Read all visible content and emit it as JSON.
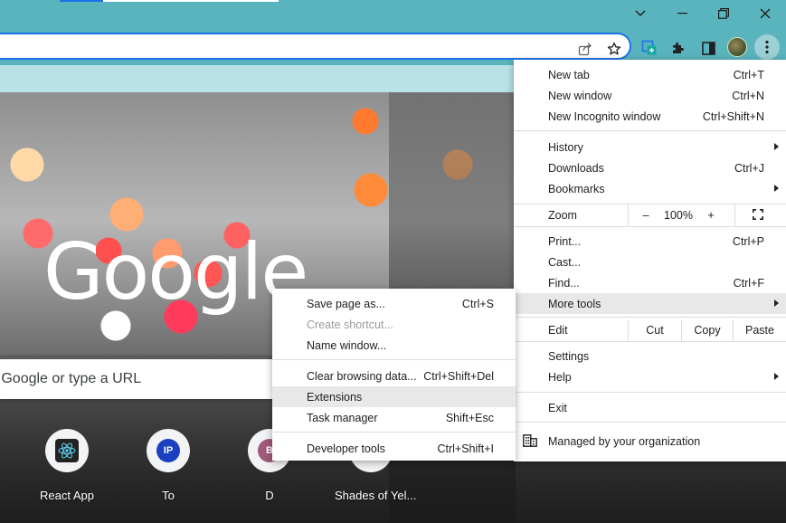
{
  "colors": {
    "titlebar": "#5ab4bd",
    "bookmarks_bar": "#b9e2e6",
    "focus_ring": "#1a73e8",
    "menu_highlight": "#e8e8e8"
  },
  "icons": {
    "window_controls": [
      "chevron-down-icon",
      "minimize-icon",
      "restore-icon",
      "close-icon"
    ],
    "omnibox": [
      "share-icon",
      "star-icon"
    ],
    "toolbar": [
      "screen-capture-icon",
      "extensions-puzzle-icon",
      "side-panel-icon",
      "profile-avatar",
      "more-vert-icon"
    ]
  },
  "ntp": {
    "logo": "Google",
    "search_placeholder": "h Google or type a URL",
    "shortcuts": [
      {
        "label": "React App",
        "icon": "react-icon"
      },
      {
        "label": "To",
        "initials": "IP"
      },
      {
        "label": "D",
        "initials": "B"
      },
      {
        "label": "Shades of Yel...",
        "icon": "blank-icon"
      }
    ]
  },
  "main_menu": {
    "items": {
      "new_tab": {
        "label": "New tab",
        "shortcut": "Ctrl+T"
      },
      "new_window": {
        "label": "New window",
        "shortcut": "Ctrl+N"
      },
      "new_incognito": {
        "label": "New Incognito window",
        "shortcut": "Ctrl+Shift+N"
      },
      "history": {
        "label": "History"
      },
      "downloads": {
        "label": "Downloads",
        "shortcut": "Ctrl+J"
      },
      "bookmarks": {
        "label": "Bookmarks"
      },
      "print": {
        "label": "Print...",
        "shortcut": "Ctrl+P"
      },
      "cast": {
        "label": "Cast..."
      },
      "find": {
        "label": "Find...",
        "shortcut": "Ctrl+F"
      },
      "more_tools": {
        "label": "More tools"
      },
      "settings": {
        "label": "Settings"
      },
      "help": {
        "label": "Help"
      },
      "exit": {
        "label": "Exit"
      },
      "managed": {
        "label": "Managed by your organization"
      }
    },
    "zoom": {
      "label": "Zoom",
      "minus": "–",
      "value": "100%",
      "plus": "+"
    },
    "edit": {
      "label": "Edit",
      "cut": "Cut",
      "copy": "Copy",
      "paste": "Paste"
    }
  },
  "sub_menu": {
    "items": {
      "save_page": {
        "label": "Save page as...",
        "shortcut": "Ctrl+S"
      },
      "create_shortcut": {
        "label": "Create shortcut..."
      },
      "name_window": {
        "label": "Name window..."
      },
      "clear_data": {
        "label": "Clear browsing data...",
        "shortcut": "Ctrl+Shift+Del"
      },
      "extensions": {
        "label": "Extensions"
      },
      "task_manager": {
        "label": "Task manager",
        "shortcut": "Shift+Esc"
      },
      "dev_tools": {
        "label": "Developer tools",
        "shortcut": "Ctrl+Shift+I"
      }
    }
  }
}
